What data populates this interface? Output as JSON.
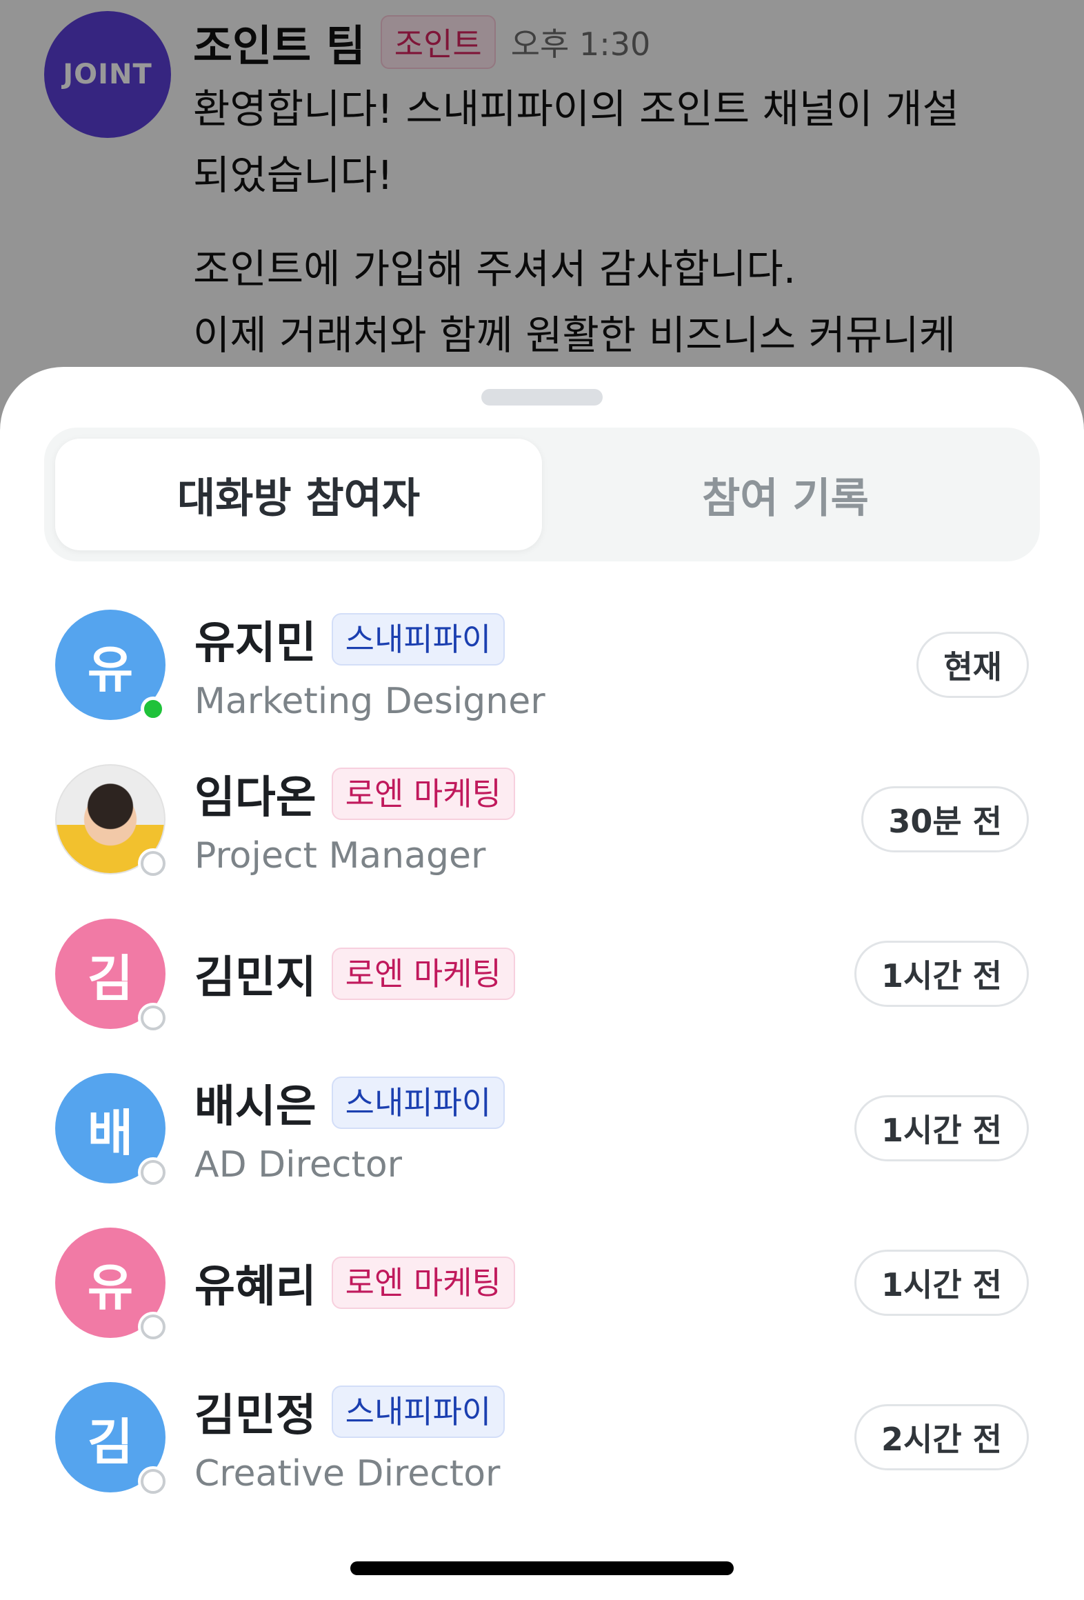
{
  "chat": {
    "avatar_text": "JOINT",
    "sender": "조인트 팀",
    "badge": "조인트",
    "time": "오후 1:30",
    "line1": "환영합니다! 스내피파이의 조인트 채널이 개설",
    "line2": "되었습니다!",
    "line3": "조인트에 가입해 주셔서 감사합니다.",
    "line4": "이제 거래처와 함께 원활한 비즈니스 커뮤니케"
  },
  "tabs": {
    "participants": "대화방 참여자",
    "history": "참여 기록"
  },
  "members": [
    {
      "initial": "유",
      "name": "유지민",
      "org": "스내피파이",
      "role": "Marketing Designer",
      "time": "현재"
    },
    {
      "initial": "",
      "name": "임다온",
      "org": "로엔 마케팅",
      "role": "Project Manager",
      "time": "30분 전"
    },
    {
      "initial": "김",
      "name": "김민지",
      "org": "로엔 마케팅",
      "role": "",
      "time": "1시간 전"
    },
    {
      "initial": "배",
      "name": "배시은",
      "org": "스내피파이",
      "role": "AD Director",
      "time": "1시간 전"
    },
    {
      "initial": "유",
      "name": "유혜리",
      "org": "로엔 마케팅",
      "role": "",
      "time": "1시간 전"
    },
    {
      "initial": "김",
      "name": "김민정",
      "org": "스내피파이",
      "role": "Creative Director",
      "time": "2시간 전"
    }
  ],
  "colors": {
    "avatar_blue": "#55a4ee",
    "avatar_pink": "#f17aa5",
    "online": "#1fc23a",
    "joint_purple": "#5b3ed6"
  }
}
